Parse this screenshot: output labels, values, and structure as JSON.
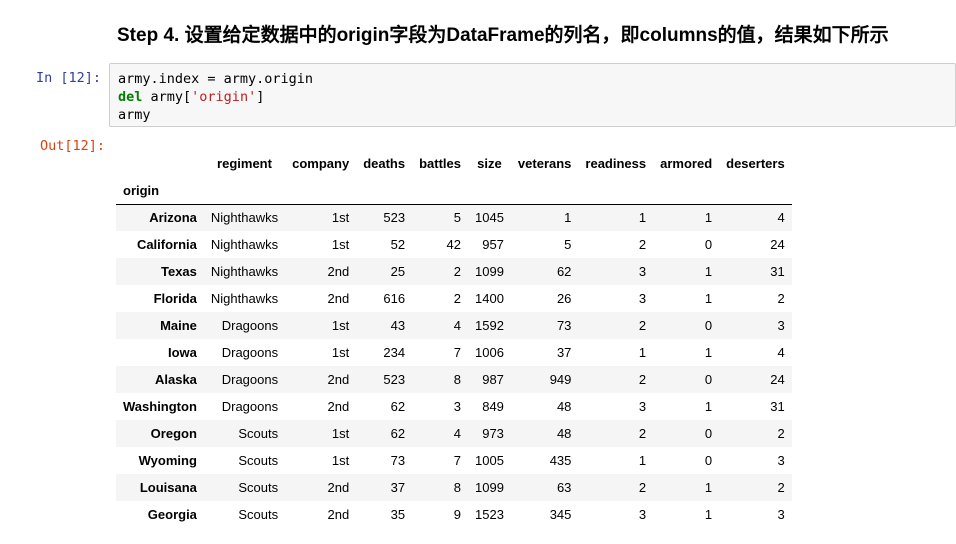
{
  "heading": "Step 4. 设置给定数据中的origin字段为DataFrame的列名，即columns的值，结果如下所示",
  "in_prompt": "In  [12]:",
  "out_prompt": "Out[12]:",
  "code": {
    "line1": "army.index = army.origin",
    "line2_kw": "del",
    "line2_mid": " army[",
    "line2_str": "'origin'",
    "line2_end": "]",
    "line3": "army"
  },
  "table": {
    "index_name": "origin",
    "columns": [
      "regiment",
      "company",
      "deaths",
      "battles",
      "size",
      "veterans",
      "readiness",
      "armored",
      "deserters"
    ],
    "rows": [
      {
        "index": "Arizona",
        "values": [
          "Nighthawks",
          "1st",
          "523",
          "5",
          "1045",
          "1",
          "1",
          "1",
          "4"
        ]
      },
      {
        "index": "California",
        "values": [
          "Nighthawks",
          "1st",
          "52",
          "42",
          "957",
          "5",
          "2",
          "0",
          "24"
        ]
      },
      {
        "index": "Texas",
        "values": [
          "Nighthawks",
          "2nd",
          "25",
          "2",
          "1099",
          "62",
          "3",
          "1",
          "31"
        ]
      },
      {
        "index": "Florida",
        "values": [
          "Nighthawks",
          "2nd",
          "616",
          "2",
          "1400",
          "26",
          "3",
          "1",
          "2"
        ]
      },
      {
        "index": "Maine",
        "values": [
          "Dragoons",
          "1st",
          "43",
          "4",
          "1592",
          "73",
          "2",
          "0",
          "3"
        ]
      },
      {
        "index": "Iowa",
        "values": [
          "Dragoons",
          "1st",
          "234",
          "7",
          "1006",
          "37",
          "1",
          "1",
          "4"
        ]
      },
      {
        "index": "Alaska",
        "values": [
          "Dragoons",
          "2nd",
          "523",
          "8",
          "987",
          "949",
          "2",
          "0",
          "24"
        ]
      },
      {
        "index": "Washington",
        "values": [
          "Dragoons",
          "2nd",
          "62",
          "3",
          "849",
          "48",
          "3",
          "1",
          "31"
        ]
      },
      {
        "index": "Oregon",
        "values": [
          "Scouts",
          "1st",
          "62",
          "4",
          "973",
          "48",
          "2",
          "0",
          "2"
        ]
      },
      {
        "index": "Wyoming",
        "values": [
          "Scouts",
          "1st",
          "73",
          "7",
          "1005",
          "435",
          "1",
          "0",
          "3"
        ]
      },
      {
        "index": "Louisana",
        "values": [
          "Scouts",
          "2nd",
          "37",
          "8",
          "1099",
          "63",
          "2",
          "1",
          "2"
        ]
      },
      {
        "index": "Georgia",
        "values": [
          "Scouts",
          "2nd",
          "35",
          "9",
          "1523",
          "345",
          "3",
          "1",
          "3"
        ]
      }
    ]
  }
}
